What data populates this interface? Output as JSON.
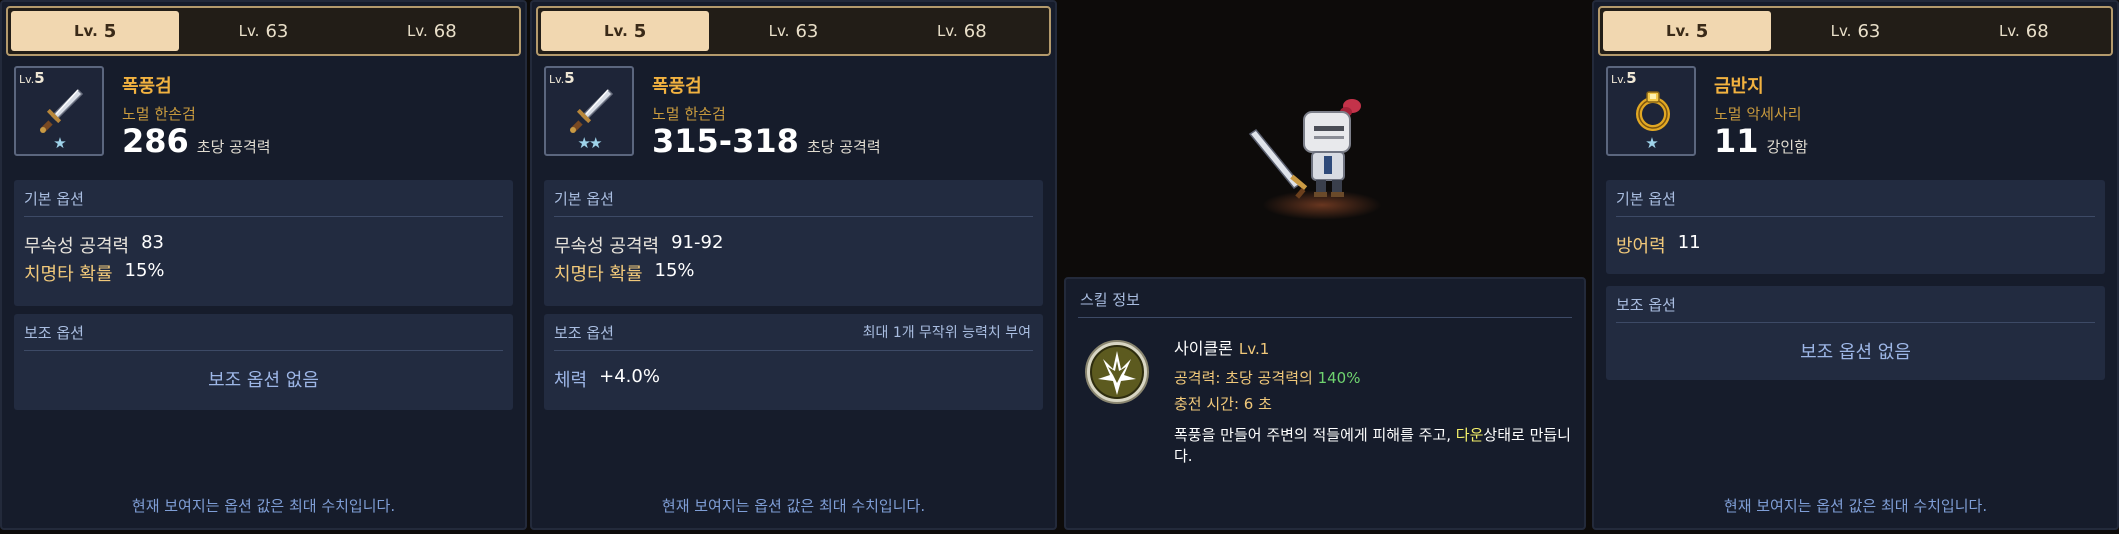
{
  "tabs": [
    {
      "lv": "Lv.",
      "num": "5"
    },
    {
      "lv": "Lv.",
      "num": "63"
    },
    {
      "lv": "Lv.",
      "num": "68"
    }
  ],
  "panels": [
    {
      "icon_lv_prefix": "Lv.",
      "icon_lv": "5",
      "stars": "★",
      "name": "폭풍검",
      "type": "노멀 한손검",
      "stat_value": "286",
      "stat_unit": "초당 공격력",
      "basic_title": "기본 옵션",
      "basic_rows": [
        {
          "k": "무속성 공격력",
          "v": "83"
        },
        {
          "k": "치명타 확률",
          "v": "15%"
        }
      ],
      "sub_title": "보조 옵션",
      "sub_none": "보조 옵션 없음",
      "footer": "현재 보여지는 옵션 값은 최대 수치입니다."
    },
    {
      "icon_lv_prefix": "Lv.",
      "icon_lv": "5",
      "stars": "★★",
      "name": "폭풍검",
      "type": "노멀 한손검",
      "stat_value": "315-318",
      "stat_unit": "초당 공격력",
      "basic_title": "기본 옵션",
      "basic_rows": [
        {
          "k": "무속성 공격력",
          "v": "91-92"
        },
        {
          "k": "치명타 확률",
          "v": "15%"
        }
      ],
      "sub_title": "보조 옵션",
      "sub_note": "최대 1개 무작위 능력치 부여",
      "sub_row": {
        "k": "체력",
        "v": "+4.0%"
      },
      "footer": "현재 보여지는 옵션 값은 최대 수치입니다."
    },
    {
      "icon_lv_prefix": "Lv.",
      "icon_lv": "5",
      "stars": "★",
      "name": "금반지",
      "type": "노멀 악세사리",
      "stat_value": "11",
      "stat_unit": "강인함",
      "basic_title": "기본 옵션",
      "basic_rows": [
        {
          "k": "방어력",
          "v": "11"
        }
      ],
      "sub_title": "보조 옵션",
      "sub_none": "보조 옵션 없음",
      "footer": "현재 보여지는 옵션 값은 최대 수치입니다."
    }
  ],
  "skill": {
    "title": "스킬 정보",
    "name": "사이클론",
    "lv": "Lv.1",
    "attack_prefix": "공격력: 초당 공격력의",
    "attack_pct": "140%",
    "cooldown": "충전 시간: 6 초",
    "desc_before": "폭풍을 만들어 주변의 적들에게 피해를 주고,",
    "desc_highlight": "다운",
    "desc_after": "상태로 만듭니다."
  },
  "colors": {
    "panel_bg": "#161c2b",
    "section_bg": "#222b40",
    "tab_active": "#f1d7b0",
    "tab_border": "#b49a6c",
    "item_name": "#f2b240",
    "accent_blue": "#9db6e6",
    "accent_green": "#6fd36f"
  },
  "icons": [
    "sword-icon",
    "ring-icon",
    "cyclone-skill-icon",
    "star-icon",
    "knight-character"
  ]
}
